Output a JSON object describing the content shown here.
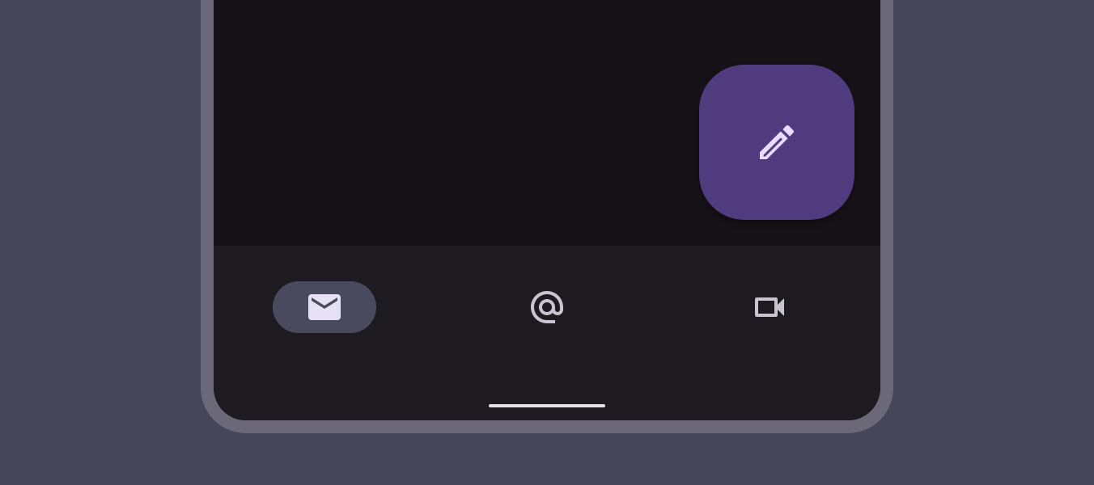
{
  "fab": {
    "icon": "pencil-icon",
    "action": "compose"
  },
  "navigation": {
    "items": [
      {
        "icon": "mail-icon",
        "selected": true
      },
      {
        "icon": "at-sign-icon",
        "selected": false
      },
      {
        "icon": "video-icon",
        "selected": false
      }
    ]
  },
  "colors": {
    "background": "#454659",
    "frame": "#6b6878",
    "content": "#151218",
    "nav_bar": "#1d1b20",
    "fab": "#4f3b7d",
    "fab_icon": "#e8ddff",
    "active_indicator": "#4a4a5e",
    "icon_active": "#e6e1f5",
    "icon_inactive": "#cac4d0"
  }
}
